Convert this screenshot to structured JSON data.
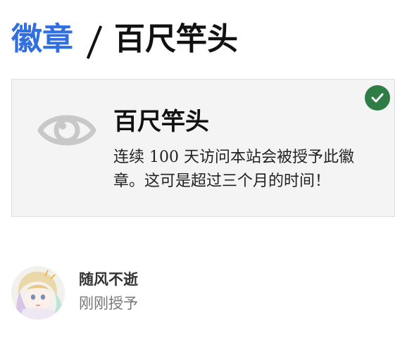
{
  "breadcrumb": {
    "parent_label": "徽章",
    "current_label": "百尺竿头"
  },
  "badge": {
    "title": "百尺竿头",
    "description": "连续 100 天访问本站会被授予此徽章。这可是超过三个月的时间！",
    "icon": "eye-icon",
    "granted_icon": "check-icon",
    "colors": {
      "icon": "#c8c8c8",
      "granted": "#2e7d46",
      "link": "#2f6fe0"
    }
  },
  "grant": {
    "user_name": "随风不逝",
    "time_label": "刚刚授予",
    "avatar_icon": "avatar"
  }
}
